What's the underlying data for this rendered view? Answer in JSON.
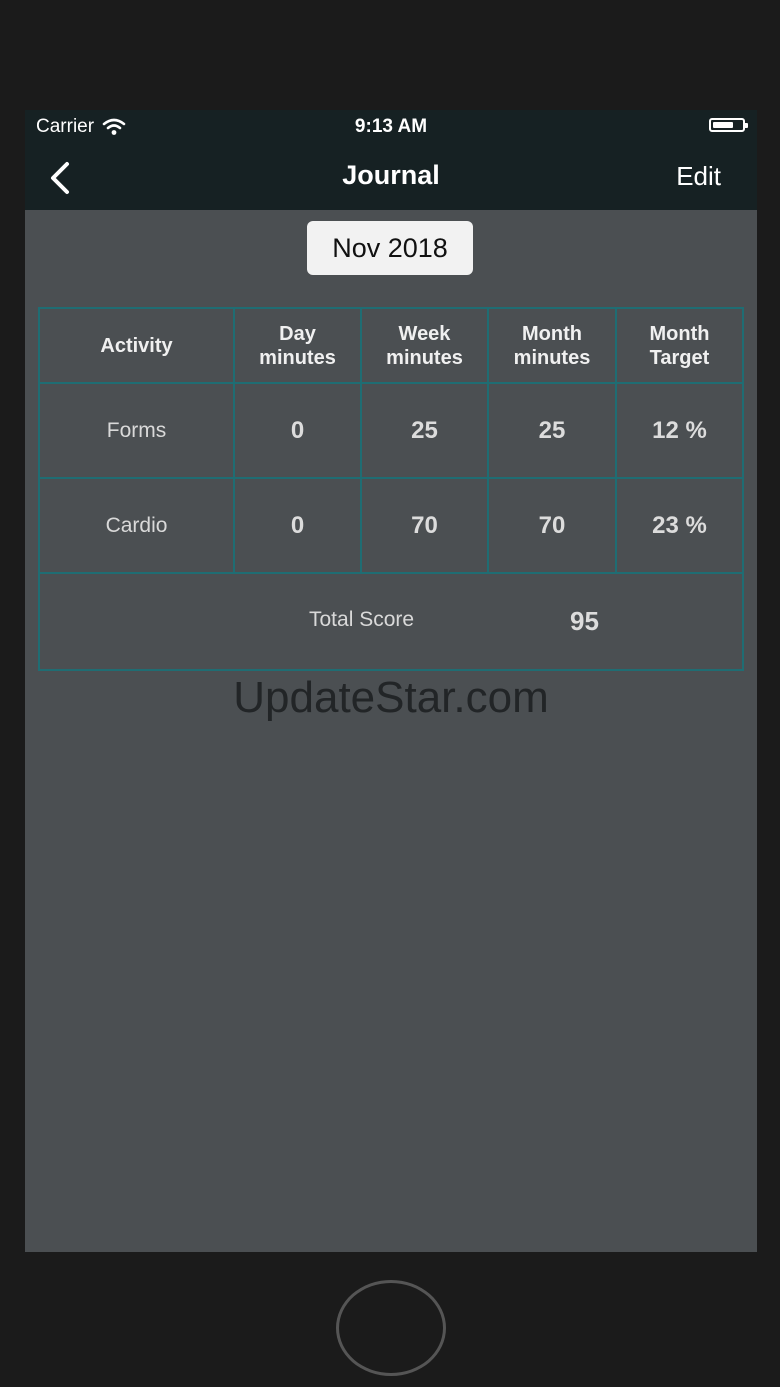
{
  "status_bar": {
    "carrier": "Carrier",
    "time": "9:13 AM",
    "battery_level": 0.7
  },
  "nav": {
    "back_icon": "chevron-left-icon",
    "title": "Journal",
    "edit_label": "Edit"
  },
  "month_picker": {
    "value": "Nov 2018"
  },
  "table": {
    "headers": {
      "activity": "Activity",
      "day_1": "Day",
      "day_2": "minutes",
      "week_1": "Week",
      "week_2": "minutes",
      "month_1": "Month",
      "month_2": "minutes",
      "target_1": "Month",
      "target_2": "Target"
    },
    "rows": [
      {
        "activity": "Forms",
        "day": "0",
        "week": "25",
        "month": "25",
        "target": "12 %"
      },
      {
        "activity": "Cardio",
        "day": "0",
        "week": "70",
        "month": "70",
        "target": "23 %"
      }
    ],
    "total_label": "Total Score",
    "total_value": "95"
  },
  "watermark": "UpdateStar.com",
  "colors": {
    "bar_background": "#162123",
    "screen_background": "#4b4f52",
    "table_border": "#1f6d73",
    "device_frame": "#1b1b1b"
  }
}
